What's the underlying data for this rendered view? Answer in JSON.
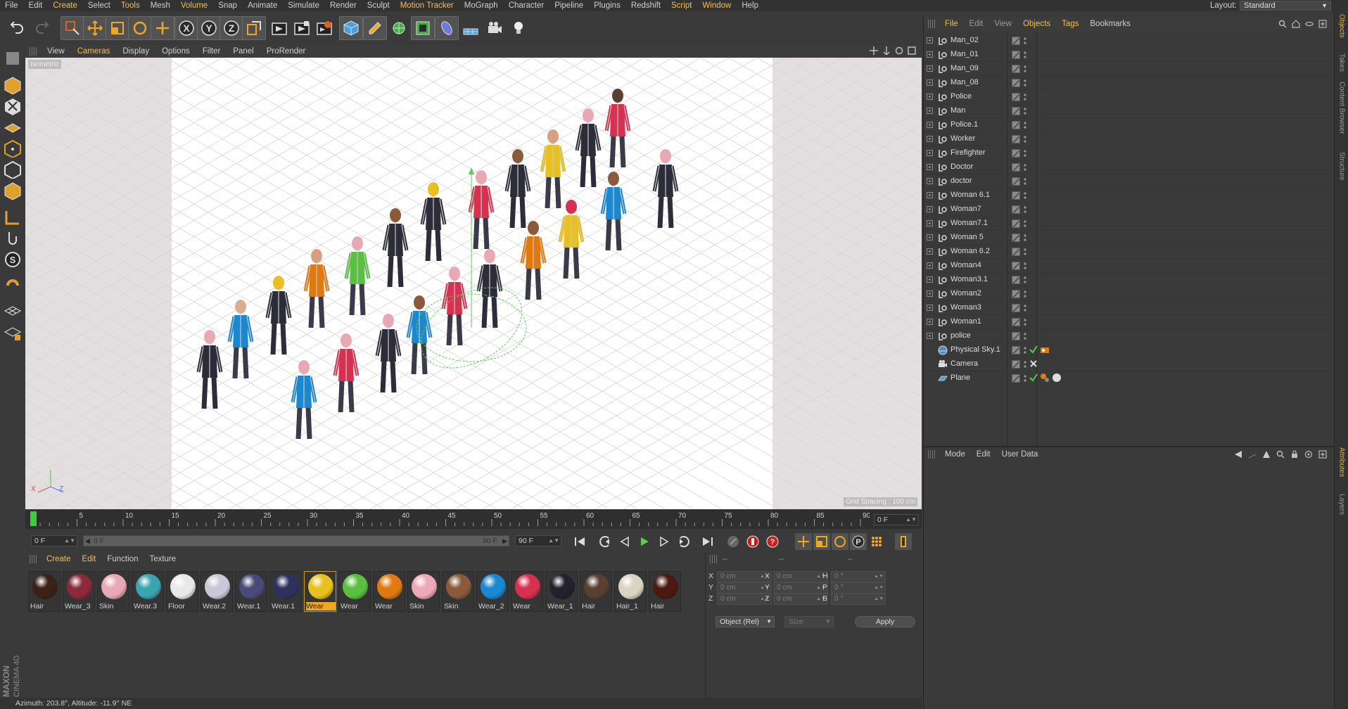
{
  "menubar": {
    "items": [
      "File",
      "Edit",
      "Create",
      "Select",
      "Tools",
      "Mesh",
      "Volume",
      "Snap",
      "Animate",
      "Simulate",
      "Render",
      "Sculpt",
      "Motion Tracker",
      "MoGraph",
      "Character",
      "Pipeline",
      "Plugins",
      "Redshift",
      "Script",
      "Window",
      "Help"
    ],
    "highlighted": [
      "Create",
      "Tools",
      "Volume",
      "Motion Tracker",
      "Script",
      "Window"
    ],
    "layout_label": "Layout:",
    "layout_value": "Standard"
  },
  "toolbar": {
    "icons": [
      "undo-icon",
      "redo-icon",
      "live-selection-icon",
      "move-icon",
      "scale-icon",
      "rotate-icon",
      "add-icon",
      "x-axis-lock-icon",
      "y-axis-lock-icon",
      "z-axis-lock-icon",
      "coordinate-system-icon",
      "render-view-icon",
      "render-picture-viewer-icon",
      "edit-render-settings-icon",
      "cube-icon",
      "pen-icon",
      "subdivision-icon",
      "array-icon",
      "deformer-icon",
      "floor-icon",
      "camera-icon",
      "light-icon"
    ]
  },
  "left_tools": {
    "icons": [
      "make-editable-icon",
      "model-mode-icon",
      "texture-mode-icon",
      "workplane-icon",
      "points-mode-icon",
      "edges-mode-icon",
      "polygons-mode-icon",
      "axis-mode-icon",
      "tweak-mode-icon",
      "solo-icon",
      "snap-icon",
      "workplane-lock-icon",
      "locked-workplane-icon"
    ],
    "brand_line1": "MAXON",
    "brand_line2": "CINEMA 4D"
  },
  "viewport": {
    "menu": [
      "View",
      "Cameras",
      "Display",
      "Options",
      "Filter",
      "Panel",
      "ProRender"
    ],
    "highlighted": [
      "Cameras"
    ],
    "camera_label": "Isometric",
    "grid_label": "Grid Spacing : 100 cm"
  },
  "timeline": {
    "ticks": [
      "0",
      "5",
      "10",
      "15",
      "20",
      "25",
      "30",
      "35",
      "40",
      "45",
      "50",
      "55",
      "60",
      "65",
      "70",
      "75",
      "80",
      "85",
      "90"
    ],
    "current_frame": "0 F"
  },
  "controls": {
    "start_frame": "0 F",
    "range_start": "0 F",
    "range_end": "90 F",
    "end_frame": "90 F"
  },
  "materials": {
    "menu": [
      "Create",
      "Edit",
      "Function",
      "Texture"
    ],
    "highlighted": [
      "Create",
      "Edit"
    ],
    "items": [
      {
        "name": "Hair",
        "color": "#3a2218"
      },
      {
        "name": "Wear_3",
        "color": "#8c2a3a"
      },
      {
        "name": "Skin",
        "color": "#e8a8b4"
      },
      {
        "name": "Wear.3",
        "color": "#3aa4b0"
      },
      {
        "name": "Floor",
        "color": "#e8e8e8"
      },
      {
        "name": "Wear.2",
        "color": "#c8c8d8"
      },
      {
        "name": "Wear.1",
        "color": "#4a4a7a"
      },
      {
        "name": "Wear.1",
        "color": "#2e3160"
      },
      {
        "name": "Wear",
        "color": "#e8c020"
      },
      {
        "name": "Wear",
        "color": "#5ac040"
      },
      {
        "name": "Wear",
        "color": "#e07a10"
      },
      {
        "name": "Skin",
        "color": "#eea8b8"
      },
      {
        "name": "Skin",
        "color": "#8a5a3a"
      },
      {
        "name": "Wear_2",
        "color": "#1a88d0"
      },
      {
        "name": "Wear",
        "color": "#d83050"
      },
      {
        "name": "Wear_1",
        "color": "#22222e"
      },
      {
        "name": "Hair",
        "color": "#5a4030"
      },
      {
        "name": "Hair_1",
        "color": "#d8d4c0"
      },
      {
        "name": "Hair",
        "color": "#4a1a10"
      }
    ],
    "selected_index": 8
  },
  "coordinates": {
    "header_dash": "--",
    "pos_labels": [
      "X",
      "Y",
      "Z"
    ],
    "size_labels": [
      "X",
      "Y",
      "Z"
    ],
    "rot_labels": [
      "H",
      "P",
      "B"
    ],
    "pos_values": [
      "0 cm",
      "0 cm",
      "0 cm"
    ],
    "size_values": [
      "0 cm",
      "0 cm",
      "0 cm"
    ],
    "rot_values": [
      "0 °",
      "0 °",
      "0 °"
    ],
    "mode": "Object (Rel)",
    "size_mode": "Size",
    "apply": "Apply"
  },
  "status": "Azimuth: 203.8°, Altitude: -11.9°  NE",
  "objects": {
    "menu": [
      "File",
      "Edit",
      "View",
      "Objects",
      "Tags",
      "Bookmarks"
    ],
    "highlighted": [
      "File",
      "Objects",
      "Tags"
    ],
    "dim": [
      "Edit",
      "View"
    ],
    "items": [
      {
        "name": "Man_02",
        "type": "null"
      },
      {
        "name": "Man_01",
        "type": "null"
      },
      {
        "name": "Man_09",
        "type": "null"
      },
      {
        "name": "Man_08",
        "type": "null"
      },
      {
        "name": "Police",
        "type": "null"
      },
      {
        "name": "Man",
        "type": "null"
      },
      {
        "name": "Police.1",
        "type": "null"
      },
      {
        "name": "Worker",
        "type": "null"
      },
      {
        "name": "Firefighter",
        "type": "null"
      },
      {
        "name": "Doctor",
        "type": "null"
      },
      {
        "name": "doctor",
        "type": "null"
      },
      {
        "name": "Woman 6.1",
        "type": "null"
      },
      {
        "name": "Woman7",
        "type": "null"
      },
      {
        "name": "Woman7.1",
        "type": "null"
      },
      {
        "name": "Woman 5",
        "type": "null"
      },
      {
        "name": "Woman 6.2",
        "type": "null"
      },
      {
        "name": "Woman4",
        "type": "null"
      },
      {
        "name": "Woman3.1",
        "type": "null"
      },
      {
        "name": "Woman2",
        "type": "null"
      },
      {
        "name": "Woman3",
        "type": "null"
      },
      {
        "name": "Woman1",
        "type": "null"
      },
      {
        "name": "police",
        "type": "null"
      },
      {
        "name": "Physical Sky.1",
        "type": "sky"
      },
      {
        "name": "Camera",
        "type": "camera"
      },
      {
        "name": "Plane",
        "type": "plane"
      }
    ]
  },
  "attributes": {
    "menu": [
      "Mode",
      "Edit",
      "User Data"
    ]
  },
  "side_tabs": {
    "top": [
      "Objects",
      "Takes",
      "Content Browser",
      "Structure"
    ],
    "bottom": [
      "Attributes",
      "Layers"
    ]
  }
}
